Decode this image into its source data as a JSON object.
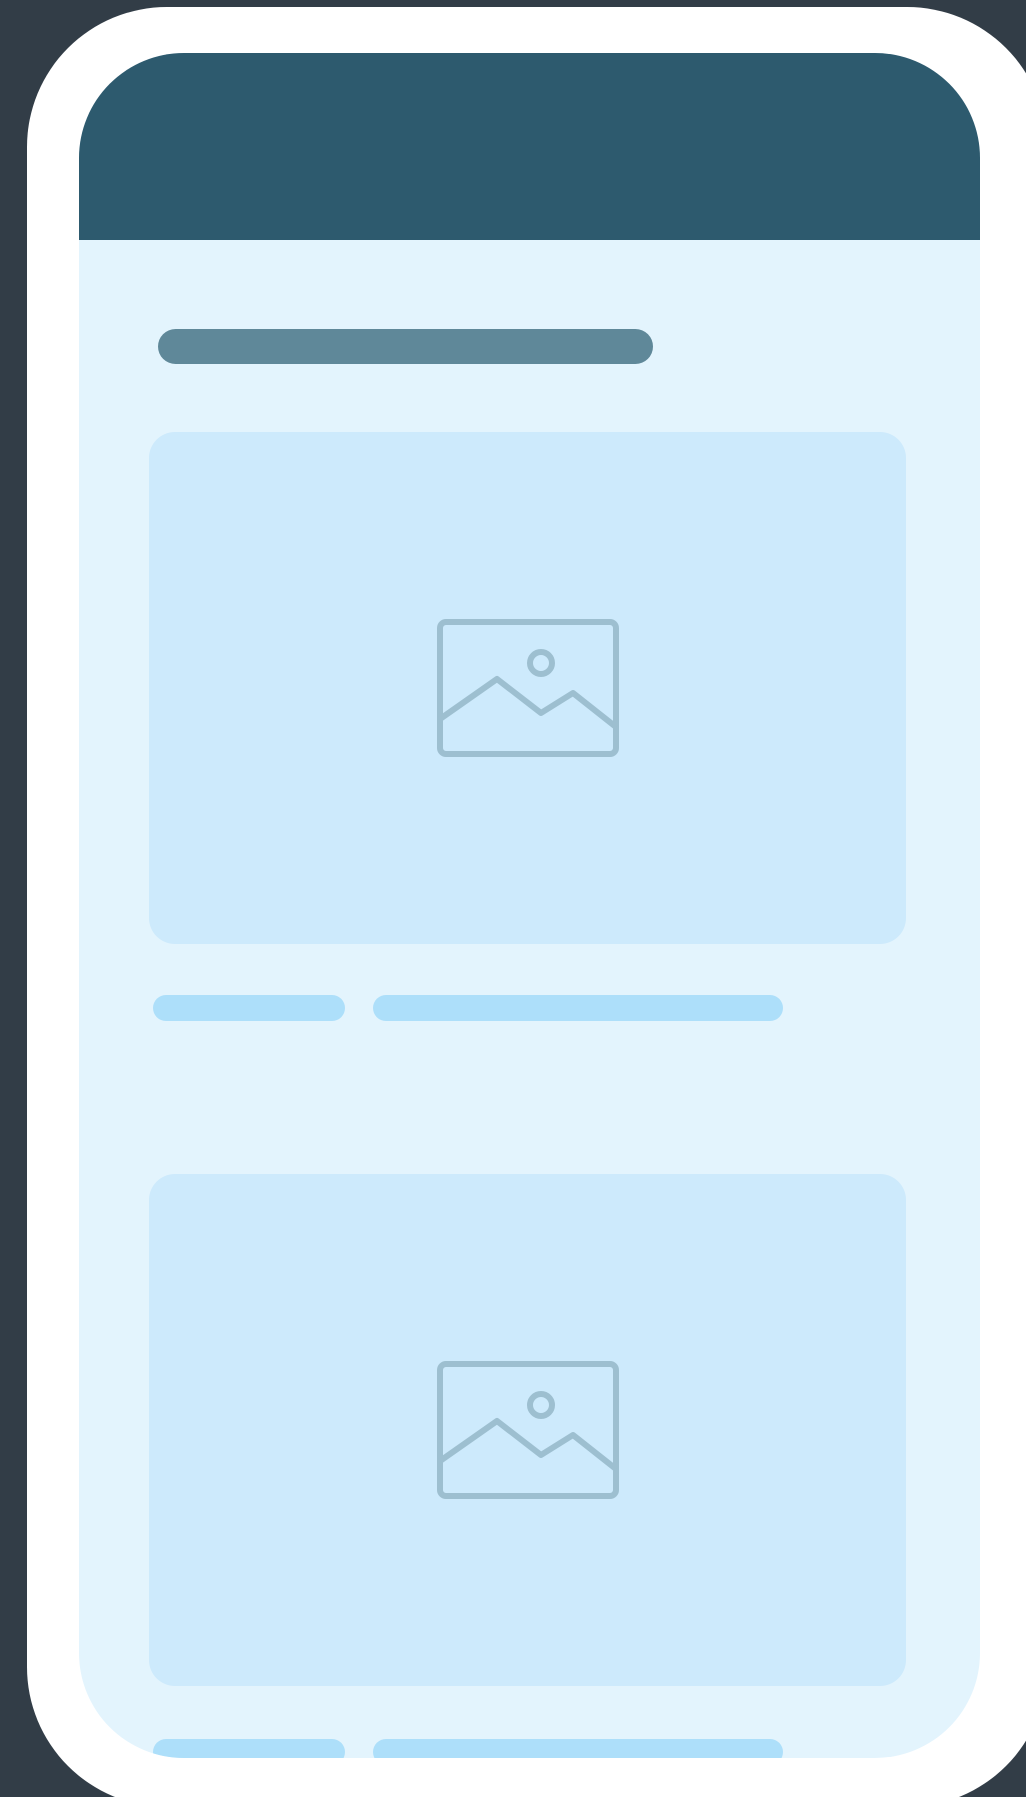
{
  "colors": {
    "backdrop": "#323d47",
    "frame": "#ffffff",
    "screen_background": "#e3f4fd",
    "header": "#2d5a6e",
    "title_placeholder": "#5f8899",
    "card_background": "#cdeafc",
    "icon_stroke": "#9dbfd0",
    "meta_placeholder": "#addffa"
  },
  "header": {},
  "feed": {
    "title_placeholder": {},
    "items": [
      {
        "media_icon": "image-placeholder-icon",
        "meta": [
          "short-placeholder",
          "long-placeholder"
        ]
      },
      {
        "media_icon": "image-placeholder-icon",
        "meta": [
          "short-placeholder",
          "long-placeholder"
        ]
      }
    ]
  }
}
